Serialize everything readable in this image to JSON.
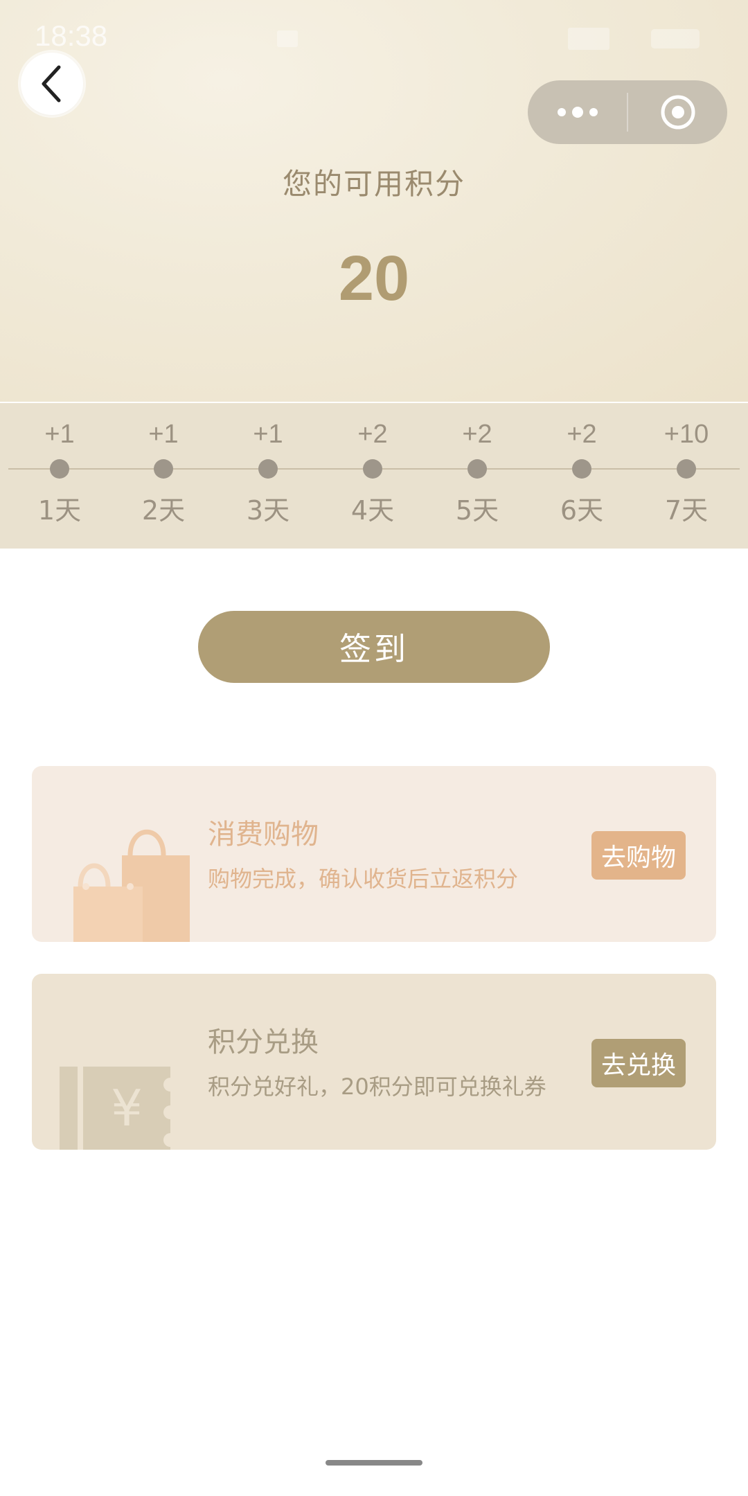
{
  "status_bar": {
    "time": "18:38"
  },
  "header": {
    "points_label": "您的可用积分",
    "points_value": "20"
  },
  "streak": [
    {
      "points": "+1",
      "day": "1天"
    },
    {
      "points": "+1",
      "day": "2天"
    },
    {
      "points": "+1",
      "day": "3天"
    },
    {
      "points": "+2",
      "day": "4天"
    },
    {
      "points": "+2",
      "day": "5天"
    },
    {
      "points": "+2",
      "day": "6天"
    },
    {
      "points": "+10",
      "day": "7天"
    }
  ],
  "checkin_label": "签到",
  "cards": {
    "shop": {
      "title": "消费购物",
      "desc": "购物完成，确认收货后立返积分",
      "button": "去购物",
      "icon": "shopping-bag-icon"
    },
    "exchange": {
      "title": "积分兑换",
      "desc": "积分兑好礼，20积分即可兑换礼券",
      "button": "去兑换",
      "icon": "yuan-coupon-icon"
    }
  },
  "colors": {
    "accent": "#b09e75",
    "shop_accent": "#e3b48a"
  }
}
